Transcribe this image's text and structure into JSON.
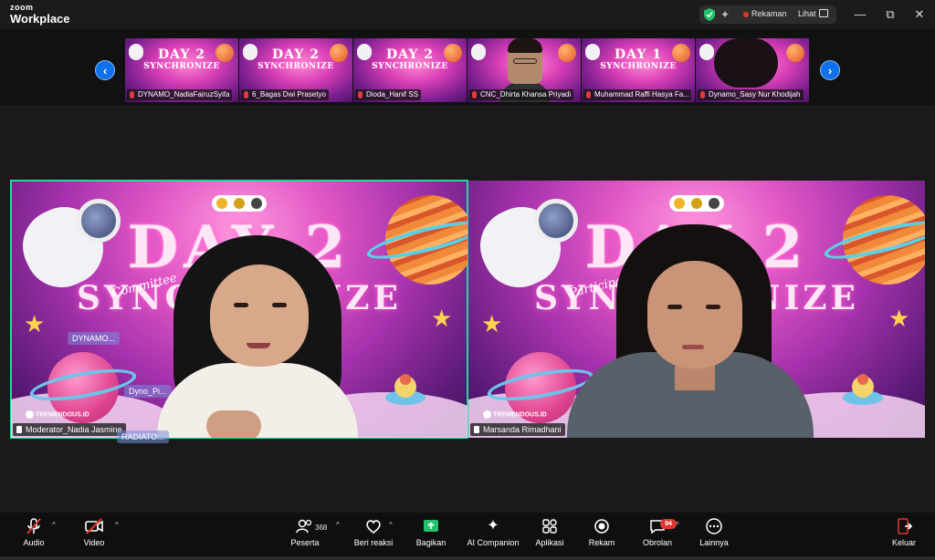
{
  "app": {
    "brand_top": "zoom",
    "brand_bottom": "Workplace"
  },
  "titlebar": {
    "recording_label": "Rekaman",
    "view_label": "Lihat",
    "minimize": "—",
    "maximize": "⧉",
    "close": "✕"
  },
  "strip": {
    "prev": "‹",
    "next": "›",
    "thumbnails": [
      {
        "name": "DYNAMO_NadiaFairuzSyifa",
        "day": "DAY 2",
        "sub": "SYNCHRONIZE"
      },
      {
        "name": "6_Bagas Dwi Prasetyo",
        "day": "DAY 2",
        "sub": "SYNCHRONIZE"
      },
      {
        "name": "Dioda_Hanif SS",
        "day": "DAY 2",
        "sub": "SYNCHRONIZE"
      },
      {
        "name": "CNC_Dhirta Khansa Priyadi",
        "day": "",
        "sub": ""
      },
      {
        "name": "Muhammad Raffi Hasya Fa...",
        "day": "DAY 1",
        "sub": "SYNCHRONIZE"
      },
      {
        "name": "Dynamo_Sasy Nur Khodijah",
        "day": "",
        "sub": ""
      }
    ]
  },
  "tiles": [
    {
      "name": "Moderator_Nadia Jasmine",
      "big_day": "DAY 2",
      "big_sync": "SYNCHRONIZE",
      "script": "Committee",
      "chips": [
        "DYNAMO...",
        "Dyno_Pi...",
        "RADIATO..."
      ],
      "logo_text": "TREMENDOUS.ID"
    },
    {
      "name": "Marsanda Rimadhani",
      "big_day": "DAY 2",
      "big_sync": "SYNCHRONIZE",
      "script": "Participant",
      "logo_text": "TREMENDOUS.ID"
    }
  ],
  "toolbar": {
    "audio": "Audio",
    "video": "Video",
    "participants": "Peserta",
    "participants_count": "368",
    "reactions": "Beri reaksi",
    "share": "Bagikan",
    "ai": "AI Companion",
    "apps": "Aplikasi",
    "record": "Rekam",
    "chat": "Obrolan",
    "chat_badge": "94",
    "more": "Lainnya",
    "leave": "Keluar"
  },
  "colors": {
    "accent": "#0e71eb",
    "active_speaker": "#23d99e",
    "record_dot": "#e0362d"
  }
}
